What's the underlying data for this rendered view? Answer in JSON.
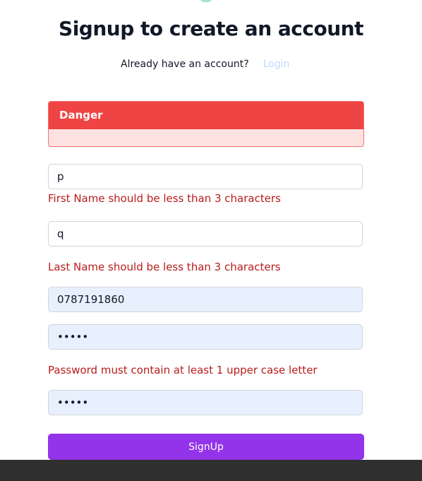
{
  "header": {
    "title": "Signup to create an account",
    "have_account_text": "Already have an account?",
    "login_link": "Login"
  },
  "alert": {
    "title": "Danger",
    "message": ""
  },
  "form": {
    "first_name_value": "p",
    "first_name_error": "First Name should be less than 3 characters",
    "last_name_value": "q",
    "last_name_error": "Last Name should be less than 3 characters",
    "phone_value": "0787191860",
    "password_value": "•••••",
    "password_error": "Password must contain at least 1 upper case letter",
    "confirm_password_value": "•••••",
    "submit_label": "SignUp"
  },
  "colors": {
    "alert_header": "#ef4444",
    "alert_body": "#fee2e2",
    "error_text": "#b91c1c",
    "button": "#9333ea",
    "autofill_bg": "#e8f0fe",
    "link": "#bfdbfe"
  }
}
